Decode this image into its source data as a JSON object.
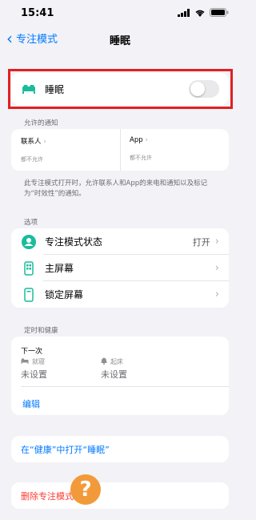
{
  "status": {
    "time": "15:41"
  },
  "nav": {
    "back_label": "专注模式",
    "title": "睡眠"
  },
  "toggle_row": {
    "label": "睡眠",
    "enabled": false
  },
  "notifications": {
    "section_label": "允许的通知",
    "people": {
      "title": "联系人",
      "subtitle": "都不允许"
    },
    "apps": {
      "title": "App",
      "subtitle": "都不允许"
    },
    "footnote": "此专注模式打开时，允许联系人和App的来电和通知以及标记为“时效性”的通知。"
  },
  "options": {
    "section_label": "选项",
    "items": [
      {
        "label": "专注模式状态",
        "value": "打开"
      },
      {
        "label": "主屏幕",
        "value": ""
      },
      {
        "label": "锁定屏幕",
        "value": ""
      }
    ]
  },
  "schedule": {
    "section_label": "定时和健康",
    "next_label": "下一次",
    "bedtime_label": "就寝",
    "bedtime_value": "未设置",
    "wake_label": "起床",
    "wake_value": "未设置",
    "edit_label": "编辑"
  },
  "health_link": "在“健康”中打开“睡眠”",
  "delete_label": "删除专注模式",
  "colors": {
    "accent": "#007aff",
    "sleep_icon": "#1abc9c",
    "danger": "#ff3b30",
    "highlight": "#e02020"
  }
}
